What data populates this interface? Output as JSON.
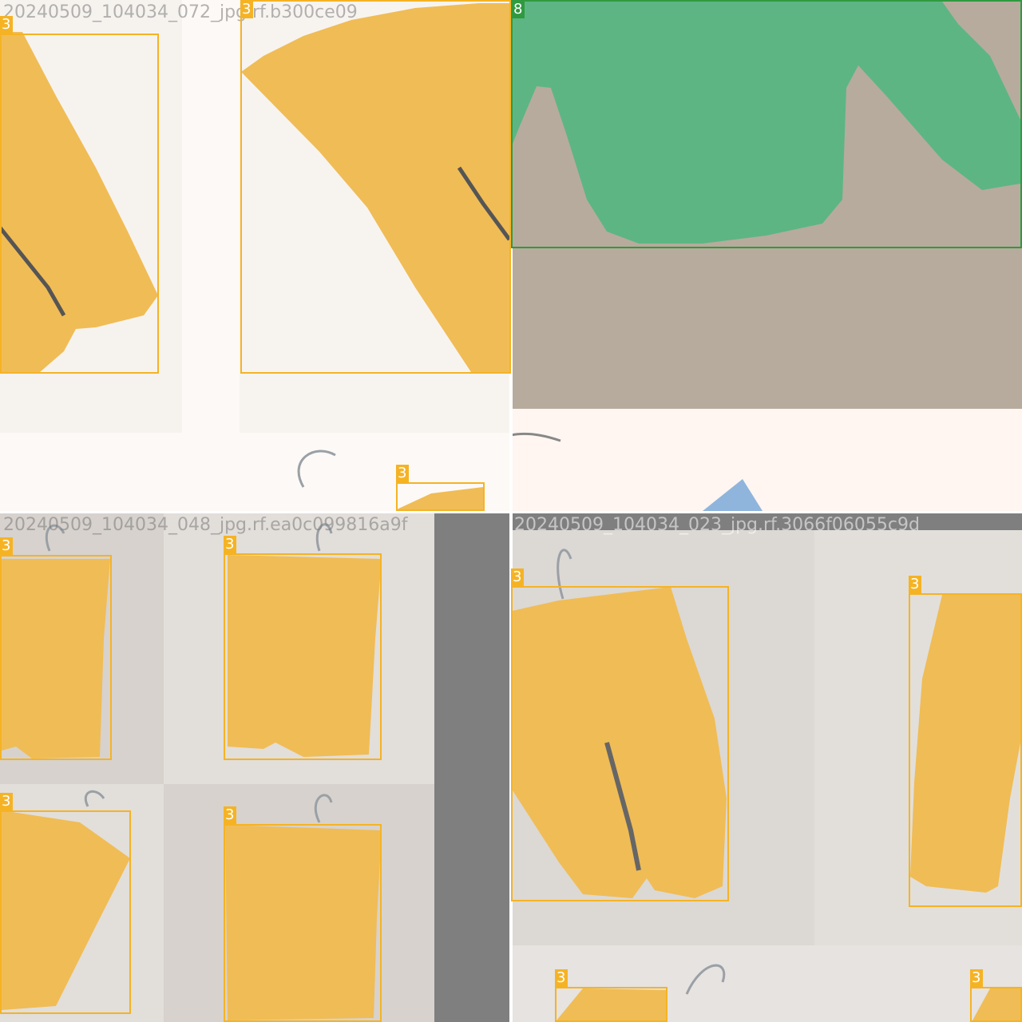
{
  "tiles": {
    "top_left": {
      "title": "20240509_104034_072_jpg.rf.b300ce09",
      "label_a": "3",
      "label_b": "3",
      "label_c": "3"
    },
    "top_right": {
      "title": "",
      "label_a": "8"
    },
    "bottom_left": {
      "title": "20240509_104034_048_jpg.rf.ea0c099816a9f",
      "label_a": "3",
      "label_b": "3",
      "label_c": "3",
      "label_d": "3"
    },
    "bottom_right": {
      "title": "20240509_104034_023_jpg.rf.3066f06055c9d",
      "label_a": "3",
      "label_b": "3",
      "label_c": "3",
      "label_d": "3"
    }
  },
  "colors": {
    "garment_mask": "#f0bc55",
    "shirt_mask": "#5db584",
    "box_yellow": "#f5b324",
    "box_green": "#2f9a3f",
    "background_grey": "#7f7f7f"
  },
  "icons": [
    "hanger-icon"
  ]
}
